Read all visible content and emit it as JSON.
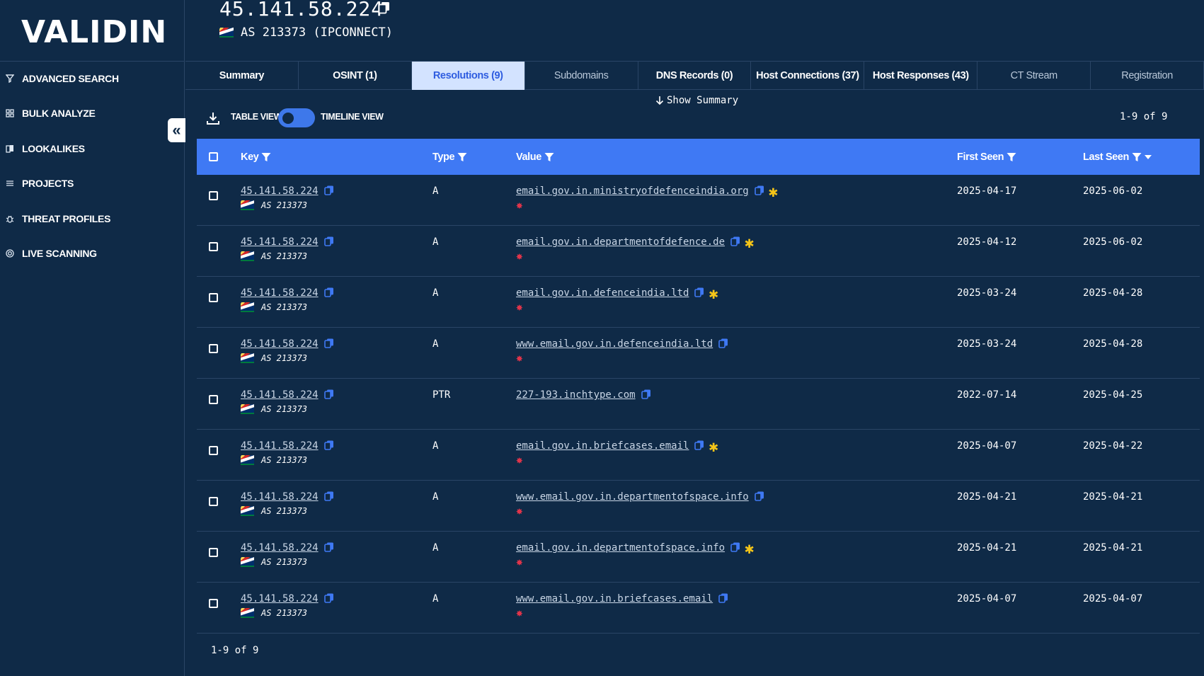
{
  "brand": {
    "logo": "VALIDIN"
  },
  "nav": [
    {
      "label": "ADVANCED SEARCH",
      "icon": "filter-icon"
    },
    {
      "label": "BULK ANALYZE",
      "icon": "grid-icon"
    },
    {
      "label": "LOOKALIKES",
      "icon": "lookalike-icon"
    },
    {
      "label": "PROJECTS",
      "icon": "list-icon"
    },
    {
      "label": "THREAT PROFILES",
      "icon": "bug-icon"
    },
    {
      "label": "LIVE SCANNING",
      "icon": "radar-icon"
    }
  ],
  "header": {
    "ip": "45.141.58.224",
    "asn": "AS 213373 (IPCONNECT)"
  },
  "tabs": [
    {
      "label": "Summary"
    },
    {
      "label": "OSINT (1)"
    },
    {
      "label": "Resolutions (9)"
    },
    {
      "label": "Subdomains"
    },
    {
      "label": "DNS Records (0)"
    },
    {
      "label": "Host Connections (37)"
    },
    {
      "label": "Host Responses (43)"
    },
    {
      "label": "CT Stream"
    },
    {
      "label": "Registration"
    }
  ],
  "toolbar": {
    "show_summary": "Show Summary",
    "table_view": "TABLE VIEW",
    "timeline_view": "TIMELINE VIEW",
    "pager": "1-9 of 9"
  },
  "table": {
    "columns": {
      "key": "Key",
      "type": "Type",
      "value": "Value",
      "first_seen": "First Seen",
      "last_seen": "Last Seen"
    },
    "rows": [
      {
        "key": "45.141.58.224",
        "as": "AS 213373",
        "type": "A",
        "value": "email.gov.in.ministryofdefenceindia.org",
        "star": "✱",
        "burst": "✸",
        "first": "2025-04-17",
        "last": "2025-06-02"
      },
      {
        "key": "45.141.58.224",
        "as": "AS 213373",
        "type": "A",
        "value": "email.gov.in.departmentofdefence.de",
        "star": "✱",
        "burst": "✸",
        "first": "2025-04-12",
        "last": "2025-06-02"
      },
      {
        "key": "45.141.58.224",
        "as": "AS 213373",
        "type": "A",
        "value": "email.gov.in.defenceindia.ltd",
        "star": "✱",
        "burst": "✸",
        "first": "2025-03-24",
        "last": "2025-04-28"
      },
      {
        "key": "45.141.58.224",
        "as": "AS 213373",
        "type": "A",
        "value": "www.email.gov.in.defenceindia.ltd",
        "star": "",
        "burst": "✸",
        "first": "2025-03-24",
        "last": "2025-04-28"
      },
      {
        "key": "45.141.58.224",
        "as": "AS 213373",
        "type": "PTR",
        "value": "227-193.inchtype.com",
        "star": "",
        "burst": "",
        "first": "2022-07-14",
        "last": "2025-04-25"
      },
      {
        "key": "45.141.58.224",
        "as": "AS 213373",
        "type": "A",
        "value": "email.gov.in.briefcases.email",
        "star": "✱",
        "burst": "✸",
        "first": "2025-04-07",
        "last": "2025-04-22"
      },
      {
        "key": "45.141.58.224",
        "as": "AS 213373",
        "type": "A",
        "value": "www.email.gov.in.departmentofspace.info",
        "star": "",
        "burst": "✸",
        "first": "2025-04-21",
        "last": "2025-04-21"
      },
      {
        "key": "45.141.58.224",
        "as": "AS 213373",
        "type": "A",
        "value": "email.gov.in.departmentofspace.info",
        "star": "✱",
        "burst": "✸",
        "first": "2025-04-21",
        "last": "2025-04-21"
      },
      {
        "key": "45.141.58.224",
        "as": "AS 213373",
        "type": "A",
        "value": "www.email.gov.in.briefcases.email",
        "star": "",
        "burst": "✸",
        "first": "2025-04-07",
        "last": "2025-04-07"
      }
    ]
  },
  "colors": {
    "background": "#0f2a47",
    "accent": "#3f79f4",
    "active_tab": "#d3e3ff",
    "star": "#f5c518",
    "burst": "#e0344a"
  }
}
